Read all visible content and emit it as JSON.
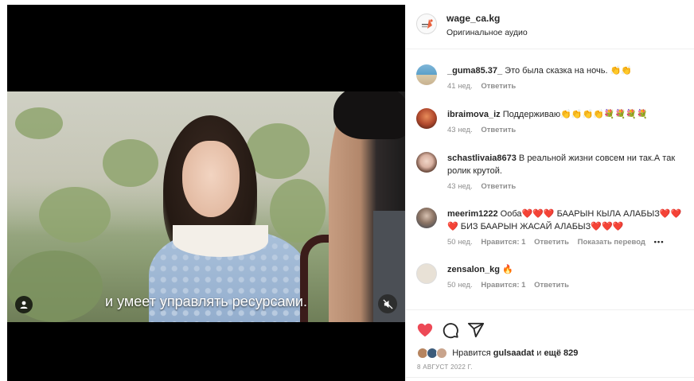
{
  "video": {
    "subtitle": "и умеет управлять ресурсами."
  },
  "header": {
    "username": "wage_ca.kg",
    "audio": "Оригинальное аудио"
  },
  "comments": [
    {
      "user": "_guma85.37_",
      "text": "Это была сказка на ночь. 👏👏",
      "time": "41 нед.",
      "likes": "",
      "reply": "Ответить",
      "extra": ""
    },
    {
      "user": "ibraimova_iz",
      "text": "Поддерживаю👏👏👏👏💐💐💐💐",
      "time": "43 нед.",
      "likes": "",
      "reply": "Ответить",
      "extra": ""
    },
    {
      "user": "schastlivaia8673",
      "text": "В реальной жизни совсем ни так.А так ролик крутой.",
      "time": "43 нед.",
      "likes": "",
      "reply": "Ответить",
      "extra": ""
    },
    {
      "user": "meerim1222",
      "text": "Ооба❤️❤️❤️ БААРЫН КЫЛА АЛАБЫЗ❤️❤️❤️ БИЗ БААРЫН ЖАСАЙ АЛАБЫЗ❤️❤️❤️",
      "time": "50 нед.",
      "likes": "Нравится: 1",
      "reply": "Ответить",
      "extra": "Показать перевод"
    },
    {
      "user": "zensalon_kg",
      "text": "🔥",
      "time": "50 нед.",
      "likes": "Нравится: 1",
      "reply": "Ответить",
      "extra": ""
    }
  ],
  "likes": {
    "prefix": "Нравится",
    "user": "gulsaadat",
    "middle": "и",
    "count": "ещё 829"
  },
  "date": "8 АВГУСТ 2022 Г.",
  "colors": {
    "like_red": "#ed4956",
    "muted_text": "#8e8e8e"
  },
  "icons": {
    "like": "heart-icon",
    "comment": "comment-icon",
    "share": "share-icon",
    "user": "user-icon",
    "mute": "muted-speaker-icon",
    "more": "more-horizontal-icon"
  }
}
